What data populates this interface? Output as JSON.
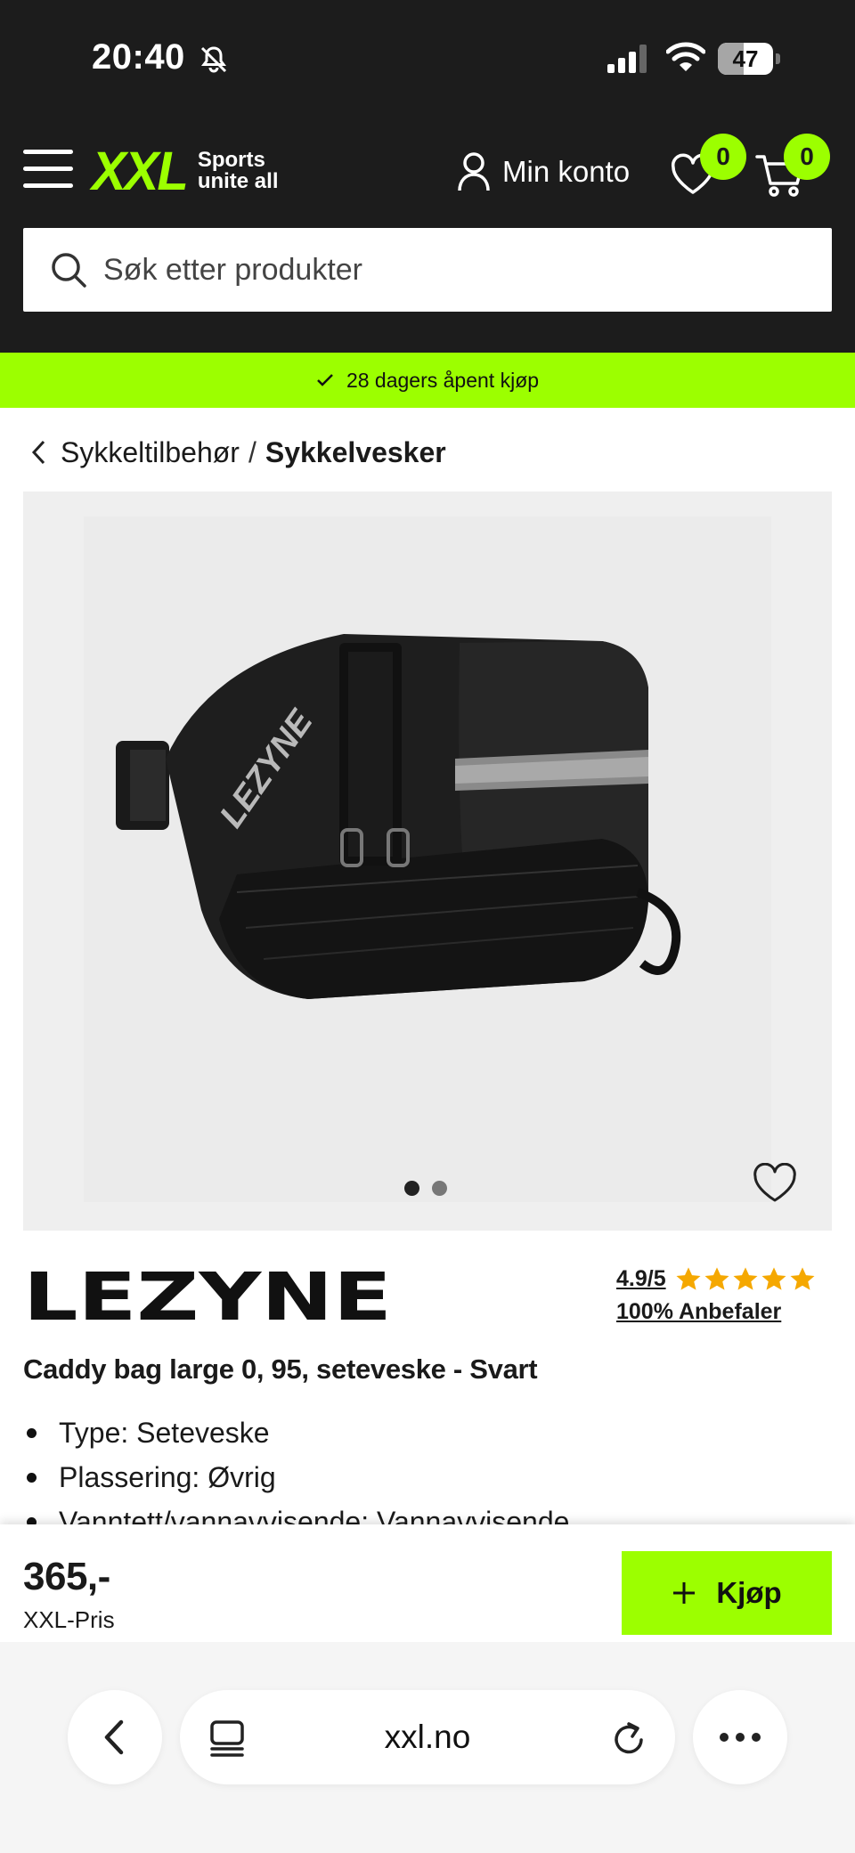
{
  "status_bar": {
    "time": "20:40",
    "battery": "47",
    "battery_level": 0.47
  },
  "header": {
    "logo_main": "XXL",
    "logo_tagline_1": "Sports",
    "logo_tagline_2": "unite all",
    "account_label": "Min konto",
    "wishlist_count": "0",
    "cart_count": "0"
  },
  "search": {
    "placeholder": "Søk etter produkter"
  },
  "promo": {
    "text": "28 dagers åpent kjøp"
  },
  "breadcrumb": {
    "parent": "Sykkeltilbehør",
    "separator": "/",
    "current": "Sykkelvesker"
  },
  "gallery": {
    "image_count": 2,
    "active_index": 0,
    "bag_print": "LEZYNE"
  },
  "product": {
    "brand": "LEZYNE",
    "rating": "4.9/5",
    "stars": 5,
    "recommend": "100% Anbefaler",
    "title": "Caddy bag large 0, 95, seteveske - Svart",
    "specs": [
      "Type: Seteveske",
      "Plassering: Øvrig",
      "Vanntett/vannavvisende: Vannavvisende"
    ]
  },
  "purchase": {
    "price": "365,-",
    "price_label": "XXL-Pris",
    "buy_label": "Kjøp"
  },
  "browser": {
    "url": "xxl.no"
  },
  "colors": {
    "accent": "#9cff00",
    "header_bg": "#1c1c1c",
    "star": "#f5a800"
  }
}
